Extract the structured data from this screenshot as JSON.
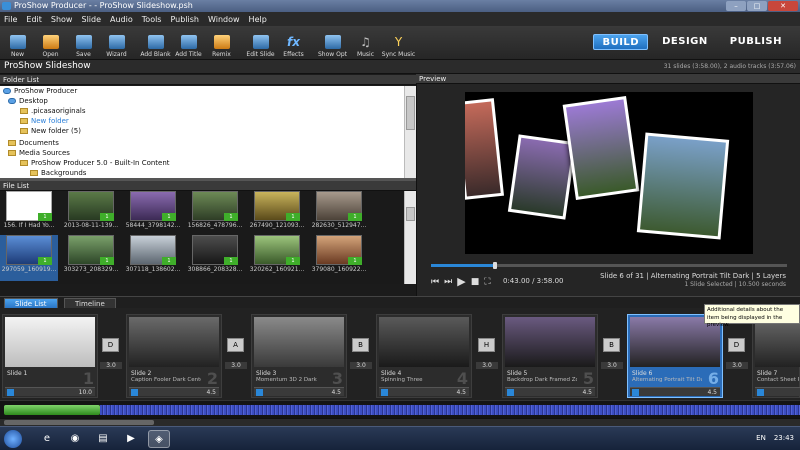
{
  "window": {
    "title": "ProShow Producer - - ProShow Slideshow.psh",
    "min_label": "–",
    "max_label": "□",
    "close_label": "✕"
  },
  "menu": [
    "File",
    "Edit",
    "Show",
    "Slide",
    "Audio",
    "Tools",
    "Publish",
    "Window",
    "Help"
  ],
  "toolbar": {
    "tools": [
      "New",
      "Open",
      "Save",
      "Wizard",
      "Add Blank",
      "Add Title",
      "Remix",
      "Edit Slide",
      "Effects",
      "Show Opt",
      "Music",
      "Sync Music"
    ],
    "modes": [
      "BUILD",
      "DESIGN",
      "PUBLISH"
    ]
  },
  "show": {
    "title": "ProShow Slideshow",
    "info": "31 slides (3:58.00), 2 audio tracks (3:57.06)"
  },
  "folder_list": {
    "header": "Folder List",
    "items": [
      "ProShow Producer",
      "Desktop",
      ".picasaoriginals",
      "New folder",
      "New folder (5)",
      "Documents",
      "Media Sources",
      "ProShow Producer 5.0 - Built-In Content",
      "Backgrounds"
    ]
  },
  "file_list": {
    "header": "File List",
    "files": [
      "156. If I Had Yo...",
      "2013-08-11-139...",
      "58444_3798142...",
      "156826_478796...",
      "267490_121093...",
      "282630_512947...",
      "297059_160919...",
      "303273_208329...",
      "307118_138602...",
      "308866_208328...",
      "320262_160921...",
      "379080_160922..."
    ],
    "badges": [
      "1",
      "1",
      "1",
      "1",
      "1",
      "1",
      "1",
      "1",
      "1",
      "1",
      "1",
      "1"
    ]
  },
  "preview": {
    "header": "Preview",
    "time": "0:43.00 / 3:58.00",
    "slide_info": "Slide 6 of 31  |  Alternating Portrait Tilt Dark  |  5 Layers",
    "selection_info": "1 Slide Selected  |  10.500 seconds",
    "controls": [
      "⏮",
      "⏭",
      "▶",
      "■",
      "⛶"
    ],
    "progress": 0.18
  },
  "tabs": [
    "Slide List",
    "Timeline"
  ],
  "tooltip": "Additional details about the item being displayed in the preview.",
  "slides": [
    {
      "name": "Slide 1",
      "desc": "",
      "num": "1",
      "dur": "10.0"
    },
    {
      "name": "Slide 2",
      "desc": "Caption Fooler Dark Center 1",
      "num": "2",
      "dur": "4.5"
    },
    {
      "name": "Slide 3",
      "desc": "Momentum 3D 2 Dark",
      "num": "3",
      "dur": "4.5"
    },
    {
      "name": "Slide 4",
      "desc": "Spinning Three",
      "num": "4",
      "dur": "4.5"
    },
    {
      "name": "Slide 5",
      "desc": "Backdrop Dark Framed Zoo...",
      "num": "5",
      "dur": "4.5"
    },
    {
      "name": "Slide 6",
      "desc": "Alternating Portrait Tilt Dark",
      "num": "6",
      "dur": "4.5"
    },
    {
      "name": "Slide 7",
      "desc": "Contact Sheet P...",
      "num": "7",
      "dur": ""
    }
  ],
  "transitions": [
    {
      "icon": "D",
      "dur": "3.0"
    },
    {
      "icon": "A",
      "dur": "3.0"
    },
    {
      "icon": "B",
      "dur": "3.0"
    },
    {
      "icon": "H",
      "dur": "3.0"
    },
    {
      "icon": "B",
      "dur": "3.0"
    },
    {
      "icon": "D",
      "dur": "3.0"
    }
  ],
  "taskbar": {
    "lang": "EN",
    "clock": "23:43"
  }
}
